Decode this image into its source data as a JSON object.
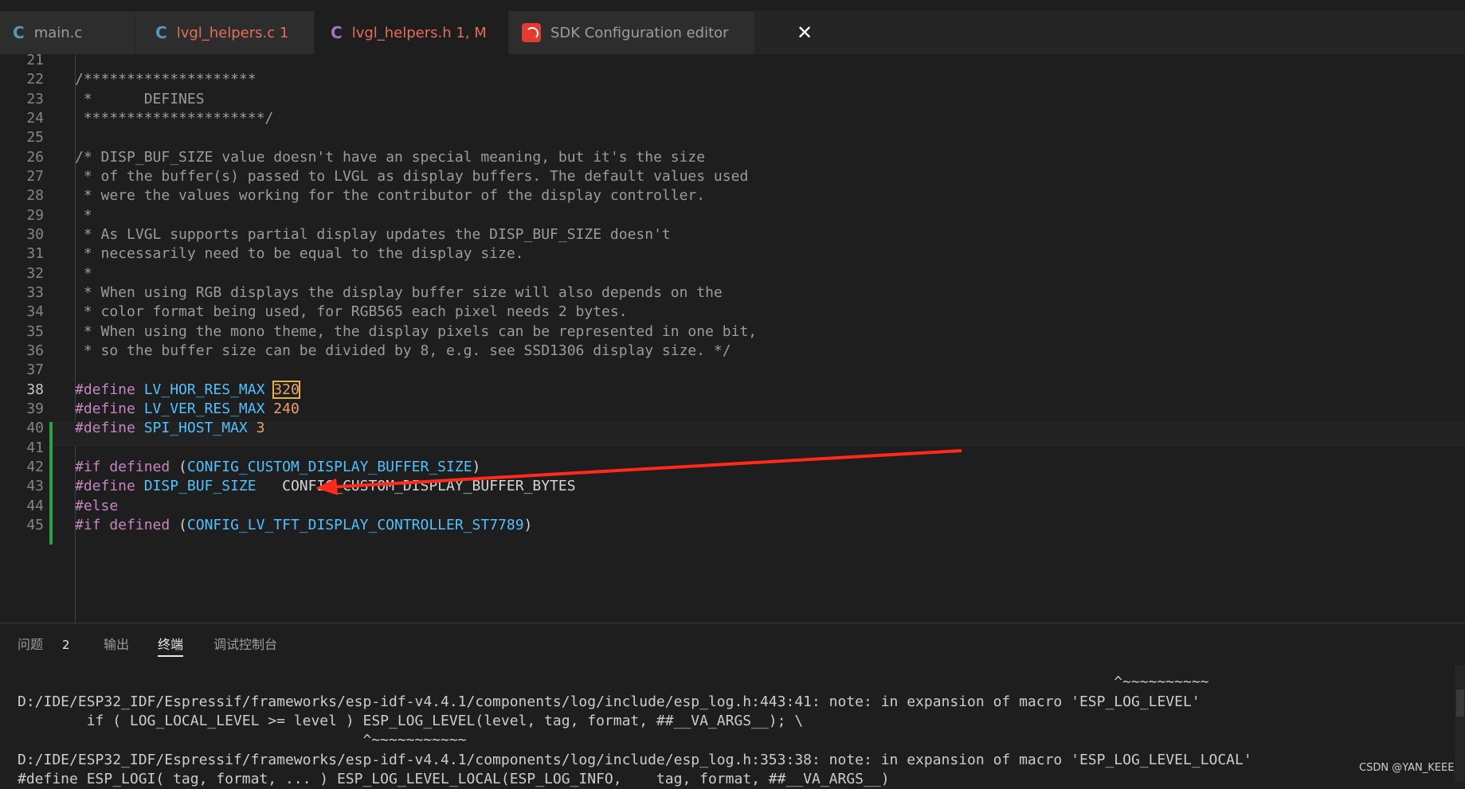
{
  "tabs": [
    {
      "icon": "C",
      "label": "main.c"
    },
    {
      "icon": "C",
      "label": "lvgl_helpers.c 1"
    },
    {
      "icon": "C",
      "label": "lvgl_helpers.h 1, M"
    },
    {
      "label": "SDK Configuration editor"
    }
  ],
  "close_glyph": "✕",
  "code_lines": [
    {
      "n": "21",
      "text": ""
    },
    {
      "n": "22",
      "text": "/********************"
    },
    {
      "n": "23",
      "text": " *      DEFINES"
    },
    {
      "n": "24",
      "text": " *********************/"
    },
    {
      "n": "25",
      "text": ""
    },
    {
      "n": "26",
      "text": "/* DISP_BUF_SIZE value doesn't have an special meaning, but it's the size"
    },
    {
      "n": "27",
      "text": " * of the buffer(s) passed to LVGL as display buffers. The default values used"
    },
    {
      "n": "28",
      "text": " * were the values working for the contributor of the display controller."
    },
    {
      "n": "29",
      "text": " *"
    },
    {
      "n": "30",
      "text": " * As LVGL supports partial display updates the DISP_BUF_SIZE doesn't"
    },
    {
      "n": "31",
      "text": " * necessarily need to be equal to the display size."
    },
    {
      "n": "32",
      "text": " *"
    },
    {
      "n": "33",
      "text": " * When using RGB displays the display buffer size will also depends on the"
    },
    {
      "n": "34",
      "text": " * color format being used, for RGB565 each pixel needs 2 bytes."
    },
    {
      "n": "35",
      "text": " * When using the mono theme, the display pixels can be represented in one bit,"
    },
    {
      "n": "36",
      "text": " * so the buffer size can be divided by 8, e.g. see SSD1306 display size. */"
    },
    {
      "n": "37",
      "text": ""
    },
    {
      "n": "38",
      "kw": "#define",
      "mac": "LV_HOR_RES_MAX",
      "num": "320"
    },
    {
      "n": "39",
      "kw": "#define",
      "mac": "LV_VER_RES_MAX",
      "num": "240"
    },
    {
      "n": "40",
      "kw": "#define",
      "mac": "SPI_HOST_MAX",
      "num": "3"
    },
    {
      "n": "41",
      "text": ""
    },
    {
      "n": "42",
      "kw": "#if defined",
      "paren_open": " (",
      "mac": "CONFIG_CUSTOM_DISPLAY_BUFFER_SIZE",
      "paren_close": ")"
    },
    {
      "n": "43",
      "kw": "#define",
      "mac": "DISP_BUF_SIZE",
      "rest": "   CONFIG_CUSTOM_DISPLAY_BUFFER_BYTES"
    },
    {
      "n": "44",
      "kw": "#else"
    },
    {
      "n": "45",
      "kw": "#if defined",
      "paren_open": " (",
      "mac": "CONFIG_LV_TFT_DISPLAY_CONTROLLER_ST7789",
      "paren_close": ")"
    }
  ],
  "panel": {
    "tabs": [
      "问题",
      "输出",
      "终端",
      "调试控制台"
    ],
    "problems_count": "2",
    "terminal_lines": [
      "                                                                                                                               ^~~~~~~~~~~",
      "D:/IDE/ESP32_IDF/Espressif/frameworks/esp-idf-v4.4.1/components/log/include/esp_log.h:443:41: note: in expansion of macro 'ESP_LOG_LEVEL'",
      "        if ( LOG_LOCAL_LEVEL >= level ) ESP_LOG_LEVEL(level, tag, format, ##__VA_ARGS__); \\",
      "                                        ^~~~~~~~~~~~",
      "D:/IDE/ESP32_IDF/Espressif/frameworks/esp-idf-v4.4.1/components/log/include/esp_log.h:353:38: note: in expansion of macro 'ESP_LOG_LEVEL_LOCAL'",
      "#define ESP_LOGI( tag, format, ... ) ESP_LOG_LEVEL_LOCAL(ESP_LOG_INFO,    tag, format, ##__VA_ARGS__)"
    ]
  },
  "watermark": "CSDN @YAN_KEEE",
  "colors": {
    "comment": "#9b9b9b",
    "keyword": "#c586c0",
    "macro": "#4fc1ff",
    "number": "#e8a36a",
    "arrow": "#ff2a1a",
    "modified_gutter": "#2ea043"
  }
}
